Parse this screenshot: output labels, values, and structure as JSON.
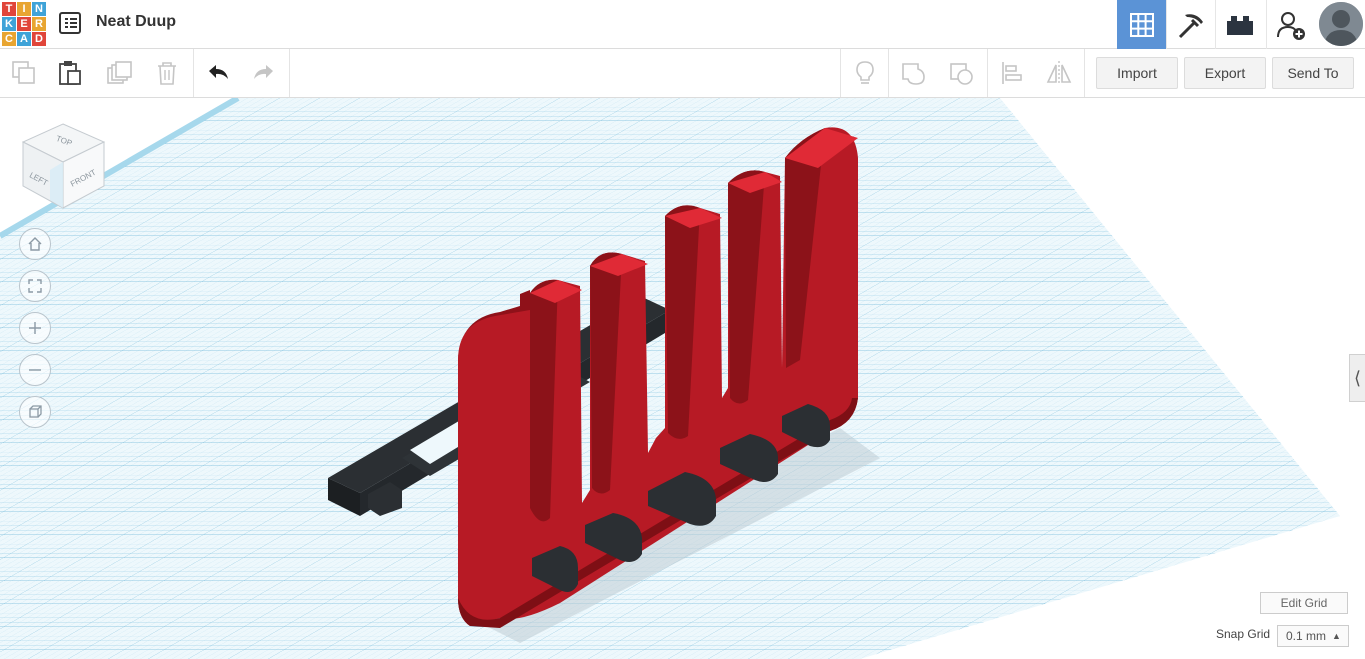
{
  "app": {
    "logo_letters": [
      "T",
      "I",
      "N",
      "K",
      "E",
      "R",
      "C",
      "A",
      "D"
    ],
    "logo_colors": [
      "#e0453a",
      "#e8a531",
      "#3fa3d8",
      "#3fa3d8",
      "#e0453a",
      "#e8a531",
      "#e8a531",
      "#3fa3d8",
      "#e0453a"
    ],
    "title": "Neat Duup"
  },
  "header": {
    "buttons": [
      {
        "name": "3d-design-view",
        "icon": "grid-icon",
        "active": true
      },
      {
        "name": "codeblocks-view",
        "icon": "pickaxe-icon",
        "active": false
      },
      {
        "name": "bricks-view",
        "icon": "brick-icon",
        "active": false
      },
      {
        "name": "invite-user",
        "icon": "add-user-icon",
        "active": false
      }
    ],
    "accent_color": "#5b93d6"
  },
  "toolbar": {
    "icons_left": [
      "copy-icon",
      "paste-icon",
      "duplicate-icon",
      "delete-icon",
      "undo-icon",
      "redo-icon"
    ],
    "icons_right": [
      "note-icon",
      "group-icon",
      "ungroup-icon",
      "align-icon",
      "mirror-icon"
    ],
    "import_label": "Import",
    "export_label": "Export",
    "send_label": "Send To"
  },
  "view_cube": {
    "top": "TOP",
    "left": "LEFT",
    "front": "FRONT"
  },
  "workplane": {
    "grid_color": "#8fc8e0",
    "model_color": "#b71a25",
    "base_color": "#2b2f33"
  },
  "footer": {
    "edit_grid_label": "Edit Grid",
    "snap_grid_label": "Snap Grid",
    "snap_grid_value": "0.1 mm"
  }
}
